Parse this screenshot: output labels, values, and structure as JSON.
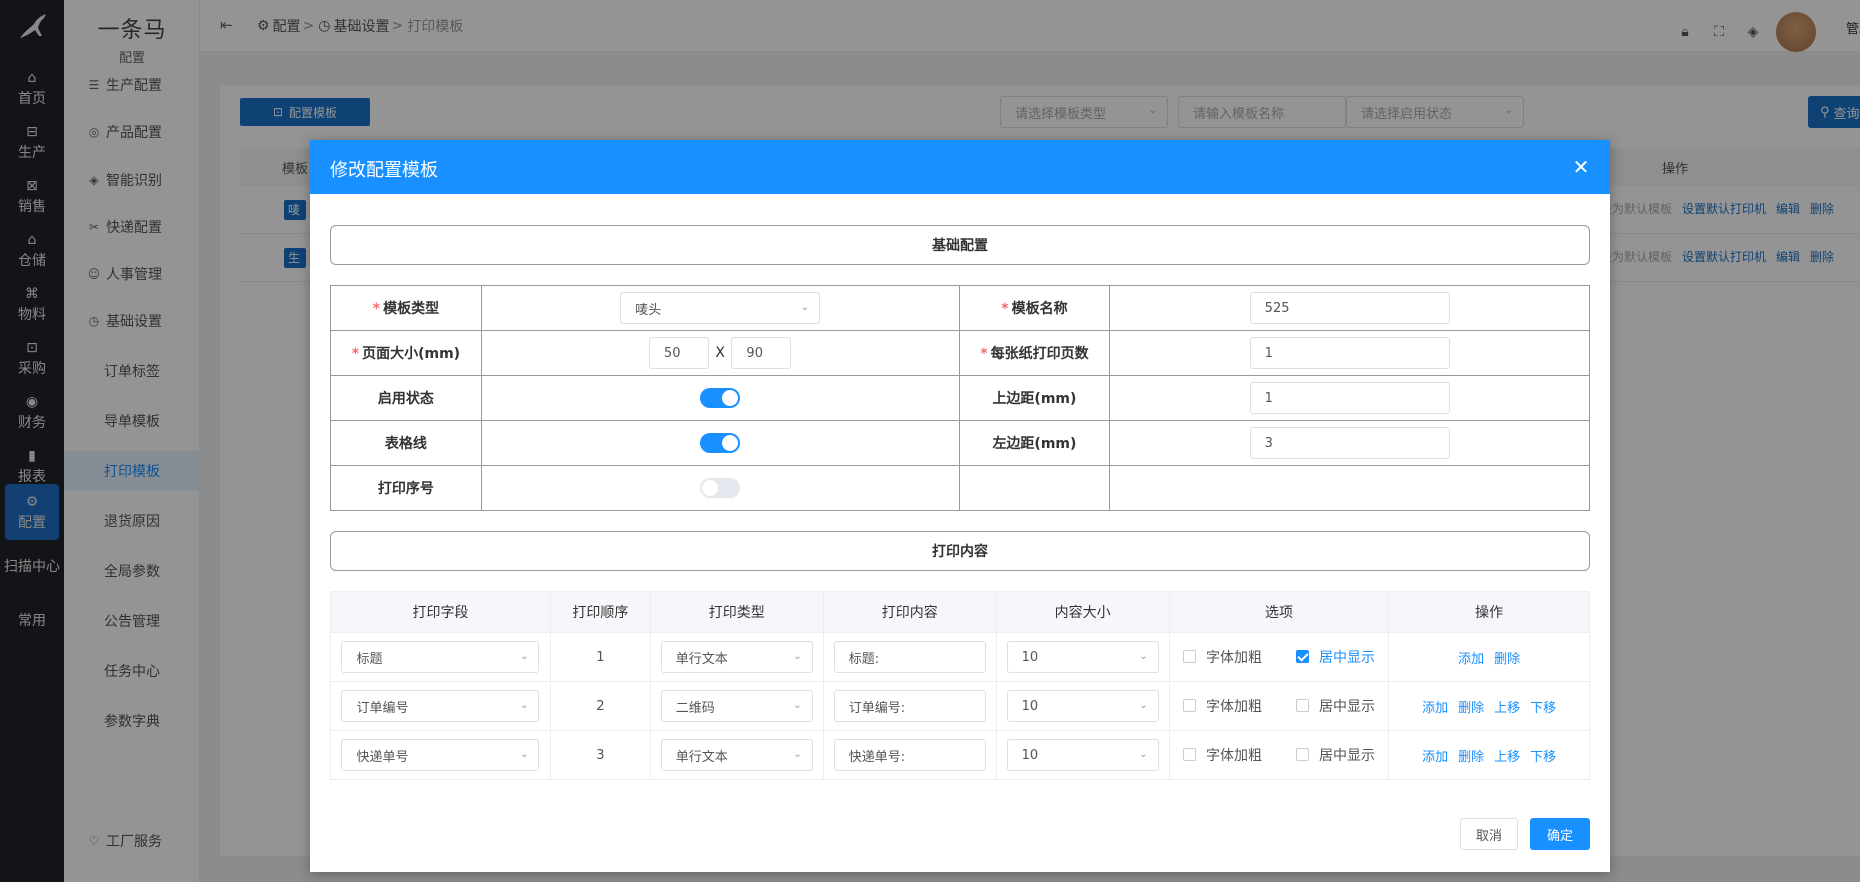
{
  "brand": {
    "name": "一条马",
    "sub": "配置"
  },
  "rail": {
    "items": [
      {
        "label": "首页",
        "icon": "home-icon"
      },
      {
        "label": "生产",
        "icon": "factory-icon"
      },
      {
        "label": "销售",
        "icon": "sales-icon"
      },
      {
        "label": "仓储",
        "icon": "warehouse-icon"
      },
      {
        "label": "物料",
        "icon": "material-icon"
      },
      {
        "label": "采购",
        "icon": "purchase-icon"
      },
      {
        "label": "财务",
        "icon": "finance-icon"
      },
      {
        "label": "报表",
        "icon": "report-icon"
      },
      {
        "label": "配置",
        "icon": "gear-icon"
      }
    ],
    "extra": [
      "扫描中心",
      "常用"
    ]
  },
  "submenu": {
    "items": [
      "生产配置",
      "产品配置",
      "智能识别",
      "快递配置",
      "人事管理",
      "基础设置"
    ],
    "sub_items": [
      "订单标签",
      "导单模板",
      "打印模板",
      "退货原因",
      "全局参数",
      "公告管理",
      "任务中心",
      "参数字典"
    ],
    "tail": "工厂服务"
  },
  "header": {
    "crumbs": [
      "配置",
      "基础设置",
      "打印模板"
    ],
    "user": "管理员"
  },
  "page": {
    "config_btn": "配置模板",
    "filter_type": "请选择模板类型",
    "filter_name": "请输入模板名称",
    "filter_status": "请选择启用状态",
    "query_btn": "查询",
    "table_col_template": "模板",
    "table_col_ops": "操作",
    "rows": [
      {
        "tag": "唛",
        "default": "设为默认模板",
        "printer": "设置默认打印机",
        "edit": "编辑",
        "del": "删除"
      },
      {
        "tag": "生",
        "default": "设为默认模板",
        "printer": "设置默认打印机",
        "edit": "编辑",
        "del": "删除"
      }
    ]
  },
  "dialog": {
    "title": "修改配置模板",
    "basic_section": "基础配置",
    "print_section": "打印内容",
    "labels": {
      "template_type": "模板类型",
      "template_name": "模板名称",
      "page_size": "页面大小(mm)",
      "pages_per_sheet": "每张纸打印页数",
      "enabled": "启用状态",
      "top_margin": "上边距(mm)",
      "grid_lines": "表格线",
      "left_margin": "左边距(mm)",
      "print_serial": "打印序号"
    },
    "values": {
      "template_type": "唛头",
      "template_name": "525",
      "page_width": "50",
      "page_x": "X",
      "page_height": "90",
      "pages_per_sheet": "1",
      "top_margin": "1",
      "left_margin": "3"
    },
    "switches": {
      "enabled": true,
      "grid_lines": true,
      "print_serial": false
    },
    "print_table": {
      "headers": [
        "打印字段",
        "打印顺序",
        "打印类型",
        "打印内容",
        "内容大小",
        "选项",
        "操作"
      ],
      "rows": [
        {
          "field": "标题",
          "order": "1",
          "type": "单行文本",
          "content": "标题:",
          "size": "10",
          "bold": false,
          "center": true,
          "ops": [
            "添加",
            "删除"
          ]
        },
        {
          "field": "订单编号",
          "order": "2",
          "type": "二维码",
          "content": "订单编号:",
          "size": "10",
          "bold": false,
          "center": false,
          "ops": [
            "添加",
            "删除",
            "上移",
            "下移"
          ]
        },
        {
          "field": "快递单号",
          "order": "3",
          "type": "单行文本",
          "content": "快递单号:",
          "size": "10",
          "bold": false,
          "center": false,
          "ops": [
            "添加",
            "删除",
            "上移",
            "下移"
          ]
        }
      ],
      "opt_bold": "字体加粗",
      "opt_center": "居中显示"
    },
    "cancel": "取消",
    "ok": "确定"
  }
}
